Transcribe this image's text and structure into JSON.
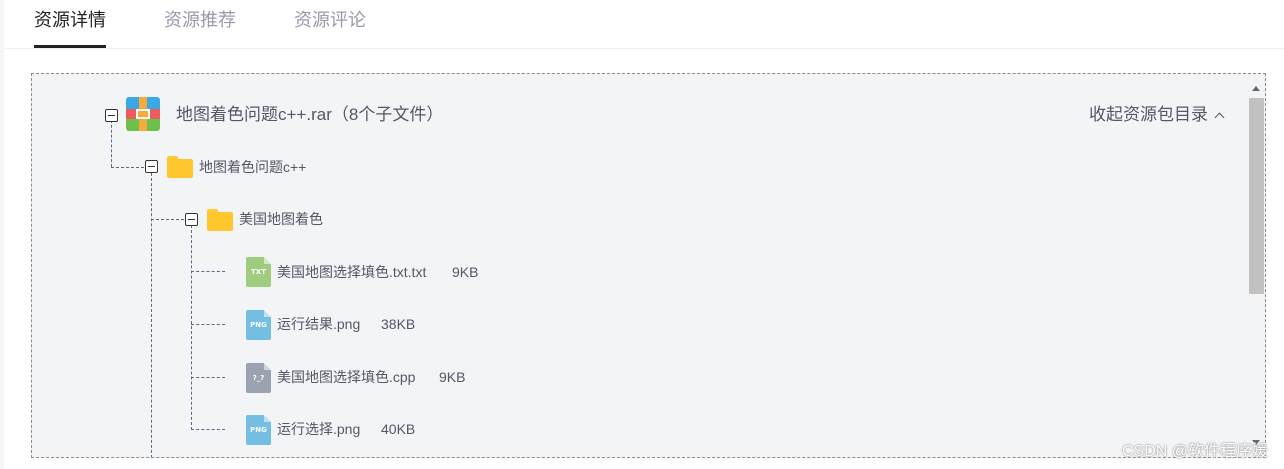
{
  "tabs": [
    {
      "label": "资源详情",
      "active": true
    },
    {
      "label": "资源推荐",
      "active": false
    },
    {
      "label": "资源评论",
      "active": false
    }
  ],
  "tree": {
    "root": {
      "name": "地图着色问题c++.rar",
      "count_text": "（8个子文件）",
      "icon": "rar-archive-icon"
    },
    "collapse_label": "收起资源包目录",
    "folder1": {
      "name": "地图着色问题c++",
      "icon": "folder-icon"
    },
    "folder2": {
      "name": "美国地图着色",
      "icon": "folder-icon"
    },
    "files": [
      {
        "name": "美国地图选择填色.txt.txt",
        "size": "9KB",
        "icon_text": "TXT",
        "icon": "txt-file-icon"
      },
      {
        "name": "运行结果.png",
        "size": "38KB",
        "icon_text": "PNG",
        "icon": "png-file-icon"
      },
      {
        "name": "美国地图选择填色.cpp",
        "size": "9KB",
        "icon_text": "?_?",
        "icon": "cpp-file-icon"
      },
      {
        "name": "运行选择.png",
        "size": "40KB",
        "icon_text": "PNG",
        "icon": "png-file-icon"
      }
    ]
  },
  "watermark": "CSDN @软件程序媛",
  "colors": {
    "accent": "#222226",
    "muted": "#999aaa",
    "folder": "#ffc62e",
    "tree_bg": "#f3f4f6"
  }
}
